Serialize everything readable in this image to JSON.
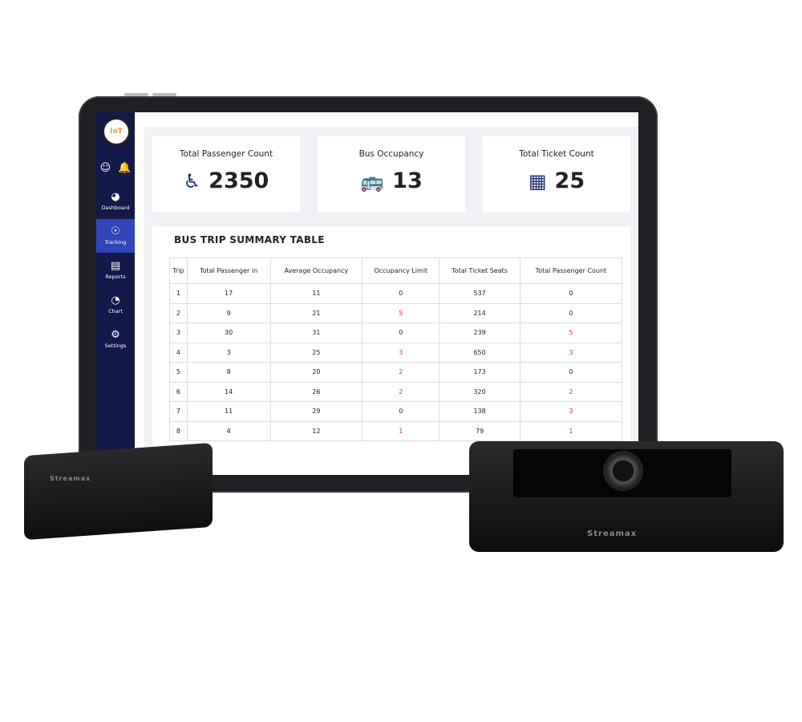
{
  "sidebar": {
    "logo_text": "IoT",
    "items": [
      {
        "label": "Dashboard",
        "icon": "speedometer-icon"
      },
      {
        "label": "Tracking",
        "icon": "location-pin-icon",
        "active": true
      },
      {
        "label": "Reports",
        "icon": "document-icon"
      },
      {
        "label": "Chart",
        "icon": "pie-chart-icon"
      },
      {
        "label": "Settings",
        "icon": "gear-icon"
      }
    ],
    "top_icons": [
      "user-icon",
      "bell-icon"
    ]
  },
  "cards": [
    {
      "title": "Total Passenger Count",
      "value": "2350",
      "icon": "seated-passenger-icon"
    },
    {
      "title": "Bus Occupancy",
      "value": "13",
      "icon": "bus-icon"
    },
    {
      "title": "Total Ticket Count",
      "value": "25",
      "icon": "ticket-counter-icon"
    }
  ],
  "table": {
    "title": "BUS TRIP SUMMARY TABLE",
    "headers": [
      "Trip",
      "Total Passenger in",
      "Average Occupancy",
      "Occupancy Limit",
      "Total Ticket Seats",
      "Total Passenger Count"
    ],
    "rows": [
      [
        "1",
        "17",
        "11",
        "0",
        "537",
        "0"
      ],
      [
        "2",
        "9",
        "21",
        "5",
        "214",
        "0"
      ],
      [
        "3",
        "30",
        "31",
        "0",
        "239",
        "5"
      ],
      [
        "4",
        "3",
        "25",
        "3",
        "650",
        "3"
      ],
      [
        "5",
        "8",
        "20",
        "2",
        "173",
        "0"
      ],
      [
        "6",
        "14",
        "26",
        "2",
        "320",
        "2"
      ],
      [
        "7",
        "11",
        "29",
        "0",
        "138",
        "3"
      ],
      [
        "8",
        "4",
        "12",
        "1",
        "79",
        "1"
      ]
    ]
  },
  "colors": {
    "sidebar": "#131a4a",
    "active": "#2f45b8",
    "alert": "#d93030",
    "icon": "#1e2f7a"
  },
  "devices": {
    "brand": "Streamax"
  }
}
